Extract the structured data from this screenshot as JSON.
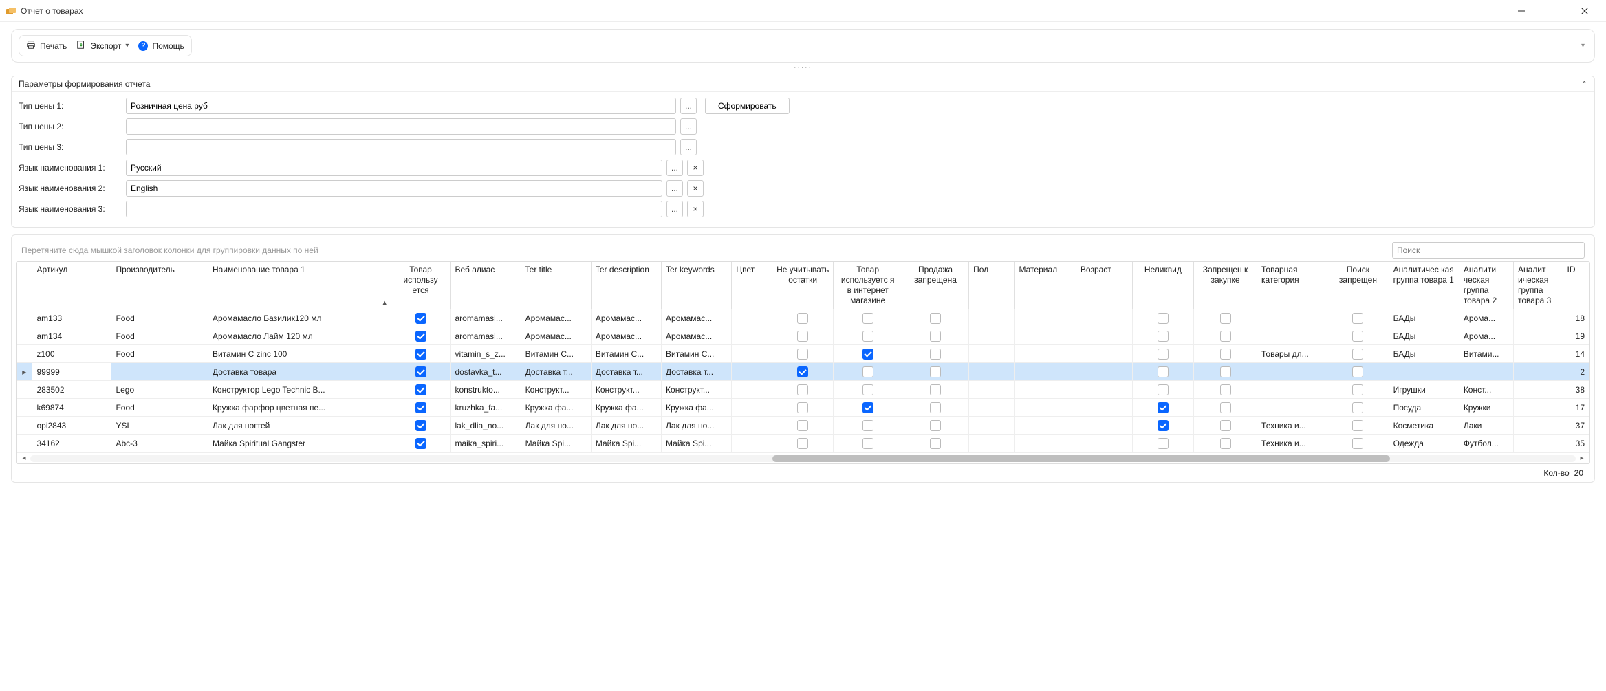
{
  "window": {
    "title": "Отчет о товарах"
  },
  "toolbar": {
    "print": "Печать",
    "export": "Экспорт",
    "help": "Помощь"
  },
  "params": {
    "header": "Параметры формирования отчета",
    "price1_label": "Тип цены 1:",
    "price1_value": "Розничная цена руб",
    "price2_label": "Тип цены 2:",
    "price2_value": "",
    "price3_label": "Тип цены 3:",
    "price3_value": "",
    "lang1_label": "Язык наименования 1:",
    "lang1_value": "Русский",
    "lang2_label": "Язык наименования 2:",
    "lang2_value": "English",
    "lang3_label": "Язык наименования 3:",
    "lang3_value": "",
    "generate": "Сформировать"
  },
  "grid": {
    "group_hint": "Перетяните сюда мышкой заголовок колонки для группировки данных по ней",
    "search_placeholder": "Поиск",
    "footer": "Кол-во=20",
    "selected_index": 3,
    "columns": {
      "art": "Артикул",
      "manufacturer": "Производитель",
      "name1": "Наименование товара 1",
      "used": "Товар использу\nется",
      "alias": "Веб алиас",
      "ter_title": "Ter title",
      "ter_desc": "Ter description",
      "ter_key": "Ter keywords",
      "color": "Цвет",
      "no_ost": "Не учитывать остатки",
      "ishop": "Товар используетс\nя в интернет магазине",
      "no_sale": "Продажа запрещена",
      "gender": "Пол",
      "material": "Материал",
      "age": "Возраст",
      "illiquid": "Неликвид",
      "no_buy": "Запрещен к закупке",
      "category": "Товарная категория",
      "no_search": "Поиск запрещен",
      "ag1": "Аналитичес\nкая группа товара 1",
      "ag2": "Аналити\nческая группа товара 2",
      "ag3": "Аналит\nическая группа товара 3",
      "id": "ID"
    },
    "rows": [
      {
        "art": "am133",
        "manufacturer": "Food",
        "name1": "Аромамасло Базилик120 мл",
        "used": true,
        "alias": "aromamasl...",
        "ter_title": "Аромамас...",
        "ter_desc": "Аромамас...",
        "ter_key": "Аромамас...",
        "color": "",
        "no_ost": false,
        "ishop": false,
        "no_sale": false,
        "gender": "",
        "material": "",
        "age": "",
        "illiquid": false,
        "no_buy": false,
        "category": "",
        "no_search": false,
        "ag1": "БАДы",
        "ag2": "Арома...",
        "ag3": "",
        "id": 18
      },
      {
        "art": "am134",
        "manufacturer": "Food",
        "name1": "Аромамасло Лайм 120 мл",
        "used": true,
        "alias": "aromamasl...",
        "ter_title": "Аромамас...",
        "ter_desc": "Аромамас...",
        "ter_key": "Аромамас...",
        "color": "",
        "no_ost": false,
        "ishop": false,
        "no_sale": false,
        "gender": "",
        "material": "",
        "age": "",
        "illiquid": false,
        "no_buy": false,
        "category": "",
        "no_search": false,
        "ag1": "БАДы",
        "ag2": "Арома...",
        "ag3": "",
        "id": 19
      },
      {
        "art": "z100",
        "manufacturer": "Food",
        "name1": "Витамин C zinc 100",
        "used": true,
        "alias": "vitamin_s_z...",
        "ter_title": "Витамин C...",
        "ter_desc": "Витамин C...",
        "ter_key": "Витамин C...",
        "color": "",
        "no_ost": false,
        "ishop": true,
        "no_sale": false,
        "gender": "",
        "material": "",
        "age": "",
        "illiquid": false,
        "no_buy": false,
        "category": "Товары дл...",
        "no_search": false,
        "ag1": "БАДы",
        "ag2": "Витами...",
        "ag3": "",
        "id": 14
      },
      {
        "art": "99999",
        "manufacturer": "",
        "name1": "Доставка товара",
        "used": true,
        "alias": "dostavka_t...",
        "ter_title": "Доставка т...",
        "ter_desc": "Доставка т...",
        "ter_key": "Доставка т...",
        "color": "",
        "no_ost": true,
        "ishop": false,
        "no_sale": false,
        "gender": "",
        "material": "",
        "age": "",
        "illiquid": false,
        "no_buy": false,
        "category": "",
        "no_search": false,
        "ag1": "",
        "ag2": "",
        "ag3": "",
        "id": 2
      },
      {
        "art": "283502",
        "manufacturer": "Lego",
        "name1": "Конструктор Lego Technic B...",
        "used": true,
        "alias": "konstrukto...",
        "ter_title": "Конструкт...",
        "ter_desc": "Конструкт...",
        "ter_key": "Конструкт...",
        "color": "",
        "no_ost": false,
        "ishop": false,
        "no_sale": false,
        "gender": "",
        "material": "",
        "age": "",
        "illiquid": false,
        "no_buy": false,
        "category": "",
        "no_search": false,
        "ag1": "Игрушки",
        "ag2": "Конст...",
        "ag3": "",
        "id": 38
      },
      {
        "art": "k69874",
        "manufacturer": "Food",
        "name1": "Кружка фарфор цветная пе...",
        "used": true,
        "alias": "kruzhka_fa...",
        "ter_title": "Кружка фа...",
        "ter_desc": "Кружка фа...",
        "ter_key": "Кружка фа...",
        "color": "",
        "no_ost": false,
        "ishop": true,
        "no_sale": false,
        "gender": "",
        "material": "",
        "age": "",
        "illiquid": true,
        "no_buy": false,
        "category": "",
        "no_search": false,
        "ag1": "Посуда",
        "ag2": "Кружки",
        "ag3": "",
        "id": 17
      },
      {
        "art": "opi2843",
        "manufacturer": "YSL",
        "name1": "Лак для ногтей",
        "used": true,
        "alias": "lak_dlia_no...",
        "ter_title": "Лак для но...",
        "ter_desc": "Лак для но...",
        "ter_key": "Лак для но...",
        "color": "",
        "no_ost": false,
        "ishop": false,
        "no_sale": false,
        "gender": "",
        "material": "",
        "age": "",
        "illiquid": true,
        "no_buy": false,
        "category": "Техника и...",
        "no_search": false,
        "ag1": "Косметика",
        "ag2": "Лаки",
        "ag3": "",
        "id": 37
      },
      {
        "art": "34162",
        "manufacturer": "Abc-3",
        "name1": "Майка Spiritual Gangster",
        "used": true,
        "alias": "maika_spiri...",
        "ter_title": "Майка Spi...",
        "ter_desc": "Майка Spi...",
        "ter_key": "Майка Spi...",
        "color": "",
        "no_ost": false,
        "ishop": false,
        "no_sale": false,
        "gender": "",
        "material": "",
        "age": "",
        "illiquid": false,
        "no_buy": false,
        "category": "Техника и...",
        "no_search": false,
        "ag1": "Одежда",
        "ag2": "Футбол...",
        "ag3": "",
        "id": 35
      }
    ]
  }
}
